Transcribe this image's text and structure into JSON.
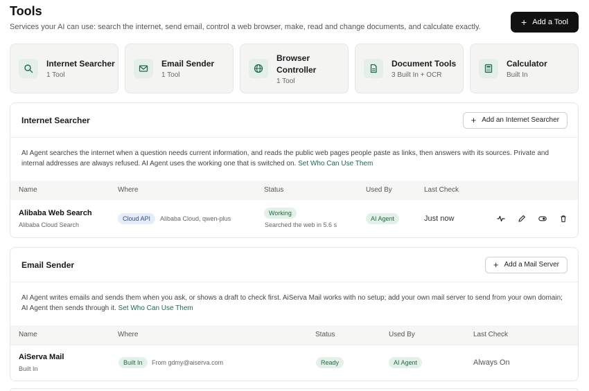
{
  "header": {
    "title": "Tools",
    "subtitle": "Services your AI can use: search the internet, send email, control a web browser, make, read and change documents, and calculate exactly.",
    "add_button": "Add a Tool"
  },
  "cards": [
    {
      "name": "Internet Searcher",
      "count": "1 Tool",
      "icon": "search-icon"
    },
    {
      "name": "Email Sender",
      "count": "1 Tool",
      "icon": "mail-icon"
    },
    {
      "name": "Browser Controller",
      "count": "1 Tool",
      "icon": "globe-icon"
    },
    {
      "name": "Document Tools",
      "count": "3 Built In + OCR",
      "icon": "document-icon"
    },
    {
      "name": "Calculator",
      "count": "Built In",
      "icon": "calculator-icon"
    }
  ],
  "internet": {
    "title": "Internet Searcher",
    "add_button": "Add an Internet Searcher",
    "description": "AI Agent searches the internet when a question needs current information, and reads the public web pages people paste as links, then answers with its sources. Private and internal addresses are always refused. AI Agent uses the working one that is switched on.",
    "link": "Set Who Can Use Them",
    "columns": {
      "name": "Name",
      "where": "Where",
      "status": "Status",
      "used_by": "Used By",
      "last_check": "Last Check"
    },
    "row": {
      "name": "Alibaba Web Search",
      "sub": "Alibaba Cloud Search",
      "where_badge": "Cloud API",
      "where_detail": "Alibaba Cloud, qwen-plus",
      "status": "Working",
      "status_detail": "Searched the web in 5.6 s",
      "used_by": "AI Agent",
      "last_check": "Just now"
    }
  },
  "email": {
    "title": "Email Sender",
    "add_button": "Add a Mail Server",
    "description": "AI Agent writes emails and sends them when you ask, or shows a draft to check first. AiServa Mail works with no setup; add your own mail server to send from your own domain; AI Agent then sends through it.",
    "link": "Set Who Can Use Them",
    "columns": {
      "name": "Name",
      "where": "Where",
      "status": "Status",
      "used_by": "Used By",
      "last_check": "Last Check"
    },
    "row": {
      "name": "AiServa Mail",
      "sub": "Built In",
      "where_badge": "Built In",
      "where_detail": "From gdmy@aiserva.com",
      "status": "Ready",
      "used_by": "AI Agent",
      "last_check": "Always On"
    }
  },
  "colors": {
    "accent": "#1c6b47",
    "badge_green_bg": "#e3f1e8",
    "badge_blue_bg": "#e6edf8",
    "button_dark": "#111111"
  }
}
